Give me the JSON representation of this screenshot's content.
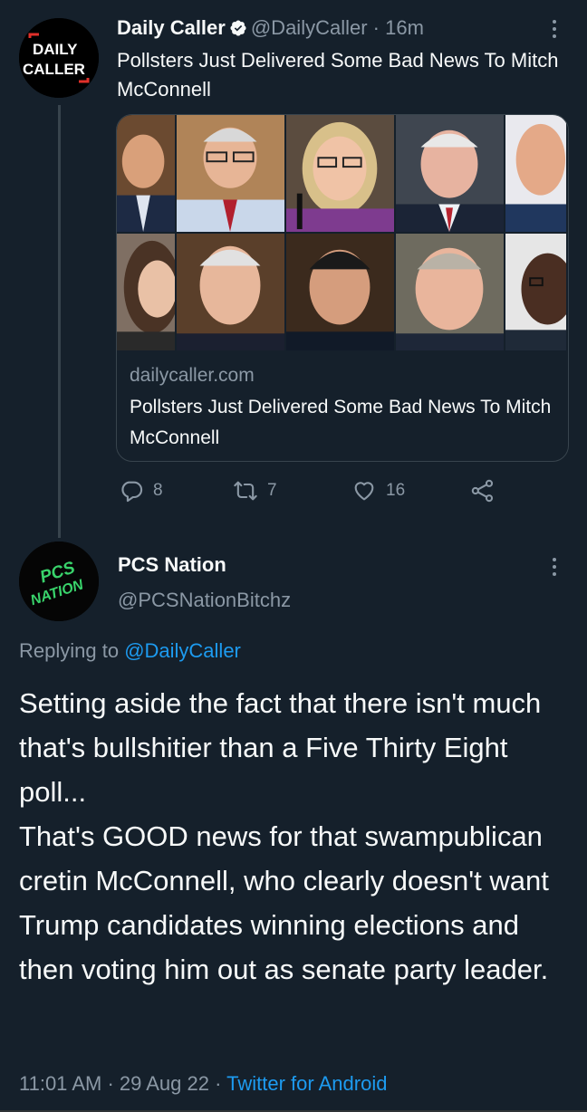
{
  "colors": {
    "background": "#15202b",
    "text_primary": "#f7f9f9",
    "text_secondary": "#8b98a5",
    "link": "#1d9bf0",
    "verified": "#f7f9f9",
    "border": "#38444d"
  },
  "parent_tweet": {
    "display_name": "Daily Caller",
    "handle": "@DailyCaller",
    "separator": " · ",
    "time_ago": "16m",
    "text": "Pollsters Just Delivered Some Bad News To Mitch McConnell",
    "avatar_logo_lines": [
      "DAILY",
      "CALLER"
    ],
    "link_card": {
      "domain": "dailycaller.com",
      "title": "Pollsters Just Delivered Some Bad News To Mitch McConnell",
      "image_description_icon": "politicians-collage"
    },
    "actions": {
      "reply_count": "8",
      "retweet_count": "7",
      "like_count": "16"
    }
  },
  "reply_tweet": {
    "display_name": "PCS Nation",
    "handle": "@PCSNationBitchz",
    "avatar_logo_lines": [
      "PCS",
      "NATION"
    ],
    "replying_to_prefix": "Replying to ",
    "replying_to_handle": "@DailyCaller",
    "text": "Setting aside the fact that there isn't much that's bullshitier than a Five Thirty Eight poll...\nThat's GOOD news for that swampublican cretin McConnell, who clearly doesn't want Trump candidates winning elections and then voting him out as senate party leader.",
    "time": "11:01 AM",
    "sep1": " · ",
    "date": "29 Aug 22",
    "sep2": " · ",
    "source": "Twitter for Android"
  }
}
